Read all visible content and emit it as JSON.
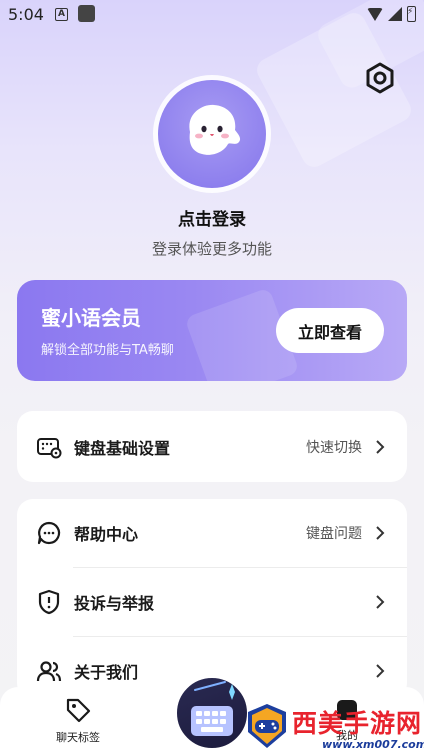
{
  "status_bar": {
    "time": "5:04",
    "notification_letter": "A"
  },
  "profile": {
    "login_title": "点击登录",
    "login_subtitle": "登录体验更多功能"
  },
  "vip": {
    "title": "蜜小语会员",
    "subtitle": "解锁全部功能与TA畅聊",
    "button": "立即查看"
  },
  "settings_card": {
    "items": [
      {
        "label": "键盘基础设置",
        "value": "快速切换",
        "icon": "keyboard-settings-icon"
      }
    ]
  },
  "help_card": {
    "items": [
      {
        "label": "帮助中心",
        "value": "键盘问题",
        "icon": "help-chat-icon"
      },
      {
        "label": "投诉与举报",
        "value": "",
        "icon": "report-shield-icon"
      },
      {
        "label": "关于我们",
        "value": "",
        "icon": "users-icon"
      }
    ]
  },
  "bottom_nav": {
    "tag_label": "聊天标签",
    "mine_label": "我的"
  },
  "watermark": {
    "text": "西美手游网",
    "url": "www.xm007.com"
  },
  "colors": {
    "accent": "#8b78f0",
    "background": "#f3f3f5",
    "watermark_red": "#e8232d"
  }
}
